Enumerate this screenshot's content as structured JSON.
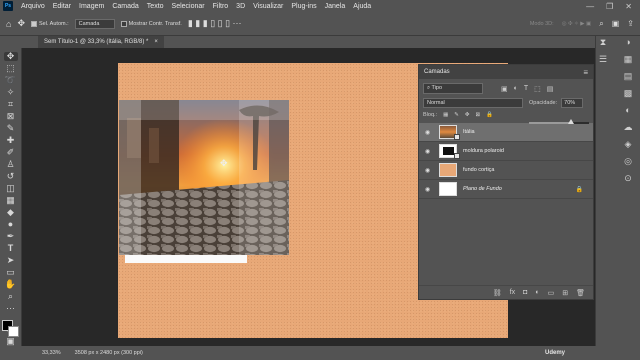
{
  "app": {
    "logo": "Ps",
    "menu": [
      "Arquivo",
      "Editar",
      "Imagem",
      "Camada",
      "Texto",
      "Selecionar",
      "Filtro",
      "3D",
      "Visualizar",
      "Plug-ins",
      "Janela",
      "Ajuda"
    ],
    "window_controls": [
      "—",
      "❐",
      "✕"
    ]
  },
  "options": {
    "auto_select_label": "Sel. Autom.:",
    "auto_select_target": "Camada",
    "show_transform_label": "Mostrar Contr. Transf.",
    "mode3d_label": "Modo 3D:"
  },
  "document": {
    "tab_title": "Sem Título-1 @ 33,3% (Itália, RGB/8) *",
    "close_glyph": "×"
  },
  "layers_panel": {
    "title": "Camadas",
    "filter_value": "Tipo",
    "blend_mode": "Normal",
    "opacity_label": "Opacidade:",
    "opacity_value": "70%",
    "opacity_fraction": 0.7,
    "lock_label": "Bloq.:",
    "layers": [
      {
        "name": "Itália",
        "selected": true,
        "italic": false,
        "thumb": "photo",
        "lock": ""
      },
      {
        "name": "moldura polaroid",
        "selected": false,
        "italic": false,
        "thumb": "polaroid",
        "lock": ""
      },
      {
        "name": "fundo cortiça",
        "selected": false,
        "italic": false,
        "thumb": "cork",
        "lock": ""
      },
      {
        "name": "Plano de Fundo",
        "selected": false,
        "italic": true,
        "thumb": "white",
        "lock": "🔒"
      }
    ],
    "footer_icons": [
      "link-icon",
      "fx-icon",
      "mask-icon",
      "adjustment-icon",
      "folder-icon",
      "new-layer-icon",
      "trash-icon"
    ],
    "footer_glyphs": [
      "⛓",
      "fx",
      "◘",
      "◐",
      "▭",
      "⊞",
      "🗑"
    ]
  },
  "status": {
    "zoom": "33,33%",
    "dimensions": "3508 px x 2480 px (300 ppi)",
    "watermark": "Udemy"
  },
  "colors": {
    "cork": "#e8a877",
    "selected_layer": "#6f6f6f",
    "panel_bg": "#535353"
  }
}
